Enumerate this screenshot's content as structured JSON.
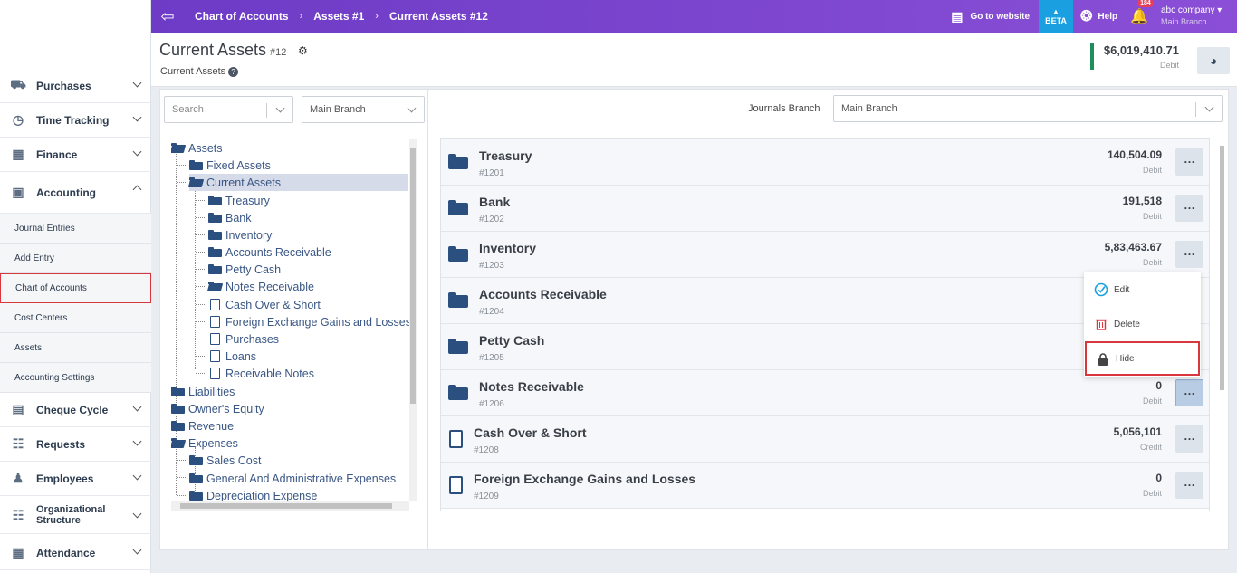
{
  "sidebar": {
    "items": [
      {
        "label": "Purchases",
        "icon": "truck-icon"
      },
      {
        "label": "Time Tracking",
        "icon": "calendar-clock-icon"
      },
      {
        "label": "Finance",
        "icon": "money-icon"
      },
      {
        "label": "Accounting",
        "icon": "cash-icon"
      },
      {
        "label": "Cheque Cycle",
        "icon": "cheque-icon"
      },
      {
        "label": "Requests",
        "icon": "clipboard-icon"
      },
      {
        "label": "Employees",
        "icon": "users-icon"
      },
      {
        "label": "Organizational Structure",
        "icon": "org-chart-icon"
      },
      {
        "label": "Attendance",
        "icon": "calendar-icon"
      }
    ],
    "accounting_sub": [
      {
        "label": "Journal Entries"
      },
      {
        "label": "Add Entry"
      },
      {
        "label": "Chart of Accounts"
      },
      {
        "label": "Cost Centers"
      },
      {
        "label": "Assets"
      },
      {
        "label": "Accounting Settings"
      }
    ]
  },
  "topbar": {
    "breadcrumb": [
      "Chart of Accounts",
      "Assets #1",
      "Current Assets #12"
    ],
    "go_to_website": "Go to website",
    "beta": "BETA",
    "help": "Help",
    "notifications_count": "184",
    "company": "abc company",
    "branch": "Main Branch",
    "accent": "#7b45cf",
    "beta_color": "#1aa0e0"
  },
  "header": {
    "title": "Current Assets",
    "number": "#12",
    "subtitle": "Current Assets",
    "balance": "$6,019,410.71",
    "balance_type": "Debit"
  },
  "filters": {
    "search_placeholder": "Search",
    "branch": "Main Branch",
    "journals_branch_label": "Journals Branch",
    "journals_branch": "Main Branch"
  },
  "tree": {
    "root": "Assets",
    "fixed_assets": "Fixed Assets",
    "current_assets": "Current Assets",
    "children": [
      "Treasury",
      "Bank",
      "Inventory",
      "Accounts Receivable",
      "Petty Cash",
      "Notes Receivable",
      "Cash Over & Short",
      "Foreign Exchange Gains and Losses",
      "Purchases",
      "Loans",
      "Receivable Notes"
    ],
    "liabilities": "Liabilities",
    "equity": "Owner's Equity",
    "revenue": "Revenue",
    "expenses": "Expenses",
    "expense_children": [
      "Sales Cost",
      "General And Administrative Expenses",
      "Depreciation Expense"
    ]
  },
  "accounts": [
    {
      "name": "Treasury",
      "code": "#1201",
      "amount": "140,504.09",
      "type": "Debit"
    },
    {
      "name": "Bank",
      "code": "#1202",
      "amount": "191,518",
      "type": "Debit"
    },
    {
      "name": "Inventory",
      "code": "#1203",
      "amount": "5,83,463.67",
      "type": "Debit"
    },
    {
      "name": "Accounts Receivable",
      "code": "#1204",
      "amount": "",
      "type": ""
    },
    {
      "name": "Petty Cash",
      "code": "#1205",
      "amount": "",
      "type": ""
    },
    {
      "name": "Notes Receivable",
      "code": "#1206",
      "amount": "0",
      "type": "Debit"
    },
    {
      "name": "Cash Over & Short",
      "code": "#1208",
      "amount": "5,056,101",
      "type": "Credit"
    },
    {
      "name": "Foreign Exchange Gains and Losses",
      "code": "#1209",
      "amount": "0",
      "type": "Debit"
    }
  ],
  "menu": {
    "edit": "Edit",
    "delete": "Delete",
    "hide": "Hide"
  }
}
